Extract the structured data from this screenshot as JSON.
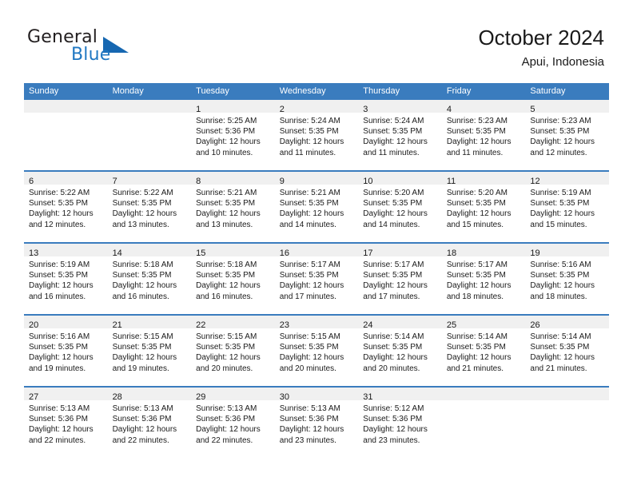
{
  "brand": {
    "name_part1": "General",
    "name_part2": "Blue",
    "logo_icon": "triangle-logo"
  },
  "header": {
    "title": "October 2024",
    "subtitle": "Apui, Indonesia"
  },
  "colors": {
    "header_blue": "#3a7cbe",
    "brand_blue": "#1f77c2",
    "day_band_gray": "#f0f0f0",
    "text": "#1a1a1a"
  },
  "weekdays": [
    "Sunday",
    "Monday",
    "Tuesday",
    "Wednesday",
    "Thursday",
    "Friday",
    "Saturday"
  ],
  "weeks": [
    [
      {
        "day": "",
        "sunrise": "",
        "sunset": "",
        "daylight_line1": "",
        "daylight_line2": ""
      },
      {
        "day": "",
        "sunrise": "",
        "sunset": "",
        "daylight_line1": "",
        "daylight_line2": ""
      },
      {
        "day": "1",
        "sunrise": "Sunrise: 5:25 AM",
        "sunset": "Sunset: 5:36 PM",
        "daylight_line1": "Daylight: 12 hours",
        "daylight_line2": "and 10 minutes."
      },
      {
        "day": "2",
        "sunrise": "Sunrise: 5:24 AM",
        "sunset": "Sunset: 5:35 PM",
        "daylight_line1": "Daylight: 12 hours",
        "daylight_line2": "and 11 minutes."
      },
      {
        "day": "3",
        "sunrise": "Sunrise: 5:24 AM",
        "sunset": "Sunset: 5:35 PM",
        "daylight_line1": "Daylight: 12 hours",
        "daylight_line2": "and 11 minutes."
      },
      {
        "day": "4",
        "sunrise": "Sunrise: 5:23 AM",
        "sunset": "Sunset: 5:35 PM",
        "daylight_line1": "Daylight: 12 hours",
        "daylight_line2": "and 11 minutes."
      },
      {
        "day": "5",
        "sunrise": "Sunrise: 5:23 AM",
        "sunset": "Sunset: 5:35 PM",
        "daylight_line1": "Daylight: 12 hours",
        "daylight_line2": "and 12 minutes."
      }
    ],
    [
      {
        "day": "6",
        "sunrise": "Sunrise: 5:22 AM",
        "sunset": "Sunset: 5:35 PM",
        "daylight_line1": "Daylight: 12 hours",
        "daylight_line2": "and 12 minutes."
      },
      {
        "day": "7",
        "sunrise": "Sunrise: 5:22 AM",
        "sunset": "Sunset: 5:35 PM",
        "daylight_line1": "Daylight: 12 hours",
        "daylight_line2": "and 13 minutes."
      },
      {
        "day": "8",
        "sunrise": "Sunrise: 5:21 AM",
        "sunset": "Sunset: 5:35 PM",
        "daylight_line1": "Daylight: 12 hours",
        "daylight_line2": "and 13 minutes."
      },
      {
        "day": "9",
        "sunrise": "Sunrise: 5:21 AM",
        "sunset": "Sunset: 5:35 PM",
        "daylight_line1": "Daylight: 12 hours",
        "daylight_line2": "and 14 minutes."
      },
      {
        "day": "10",
        "sunrise": "Sunrise: 5:20 AM",
        "sunset": "Sunset: 5:35 PM",
        "daylight_line1": "Daylight: 12 hours",
        "daylight_line2": "and 14 minutes."
      },
      {
        "day": "11",
        "sunrise": "Sunrise: 5:20 AM",
        "sunset": "Sunset: 5:35 PM",
        "daylight_line1": "Daylight: 12 hours",
        "daylight_line2": "and 15 minutes."
      },
      {
        "day": "12",
        "sunrise": "Sunrise: 5:19 AM",
        "sunset": "Sunset: 5:35 PM",
        "daylight_line1": "Daylight: 12 hours",
        "daylight_line2": "and 15 minutes."
      }
    ],
    [
      {
        "day": "13",
        "sunrise": "Sunrise: 5:19 AM",
        "sunset": "Sunset: 5:35 PM",
        "daylight_line1": "Daylight: 12 hours",
        "daylight_line2": "and 16 minutes."
      },
      {
        "day": "14",
        "sunrise": "Sunrise: 5:18 AM",
        "sunset": "Sunset: 5:35 PM",
        "daylight_line1": "Daylight: 12 hours",
        "daylight_line2": "and 16 minutes."
      },
      {
        "day": "15",
        "sunrise": "Sunrise: 5:18 AM",
        "sunset": "Sunset: 5:35 PM",
        "daylight_line1": "Daylight: 12 hours",
        "daylight_line2": "and 16 minutes."
      },
      {
        "day": "16",
        "sunrise": "Sunrise: 5:17 AM",
        "sunset": "Sunset: 5:35 PM",
        "daylight_line1": "Daylight: 12 hours",
        "daylight_line2": "and 17 minutes."
      },
      {
        "day": "17",
        "sunrise": "Sunrise: 5:17 AM",
        "sunset": "Sunset: 5:35 PM",
        "daylight_line1": "Daylight: 12 hours",
        "daylight_line2": "and 17 minutes."
      },
      {
        "day": "18",
        "sunrise": "Sunrise: 5:17 AM",
        "sunset": "Sunset: 5:35 PM",
        "daylight_line1": "Daylight: 12 hours",
        "daylight_line2": "and 18 minutes."
      },
      {
        "day": "19",
        "sunrise": "Sunrise: 5:16 AM",
        "sunset": "Sunset: 5:35 PM",
        "daylight_line1": "Daylight: 12 hours",
        "daylight_line2": "and 18 minutes."
      }
    ],
    [
      {
        "day": "20",
        "sunrise": "Sunrise: 5:16 AM",
        "sunset": "Sunset: 5:35 PM",
        "daylight_line1": "Daylight: 12 hours",
        "daylight_line2": "and 19 minutes."
      },
      {
        "day": "21",
        "sunrise": "Sunrise: 5:15 AM",
        "sunset": "Sunset: 5:35 PM",
        "daylight_line1": "Daylight: 12 hours",
        "daylight_line2": "and 19 minutes."
      },
      {
        "day": "22",
        "sunrise": "Sunrise: 5:15 AM",
        "sunset": "Sunset: 5:35 PM",
        "daylight_line1": "Daylight: 12 hours",
        "daylight_line2": "and 20 minutes."
      },
      {
        "day": "23",
        "sunrise": "Sunrise: 5:15 AM",
        "sunset": "Sunset: 5:35 PM",
        "daylight_line1": "Daylight: 12 hours",
        "daylight_line2": "and 20 minutes."
      },
      {
        "day": "24",
        "sunrise": "Sunrise: 5:14 AM",
        "sunset": "Sunset: 5:35 PM",
        "daylight_line1": "Daylight: 12 hours",
        "daylight_line2": "and 20 minutes."
      },
      {
        "day": "25",
        "sunrise": "Sunrise: 5:14 AM",
        "sunset": "Sunset: 5:35 PM",
        "daylight_line1": "Daylight: 12 hours",
        "daylight_line2": "and 21 minutes."
      },
      {
        "day": "26",
        "sunrise": "Sunrise: 5:14 AM",
        "sunset": "Sunset: 5:35 PM",
        "daylight_line1": "Daylight: 12 hours",
        "daylight_line2": "and 21 minutes."
      }
    ],
    [
      {
        "day": "27",
        "sunrise": "Sunrise: 5:13 AM",
        "sunset": "Sunset: 5:36 PM",
        "daylight_line1": "Daylight: 12 hours",
        "daylight_line2": "and 22 minutes."
      },
      {
        "day": "28",
        "sunrise": "Sunrise: 5:13 AM",
        "sunset": "Sunset: 5:36 PM",
        "daylight_line1": "Daylight: 12 hours",
        "daylight_line2": "and 22 minutes."
      },
      {
        "day": "29",
        "sunrise": "Sunrise: 5:13 AM",
        "sunset": "Sunset: 5:36 PM",
        "daylight_line1": "Daylight: 12 hours",
        "daylight_line2": "and 22 minutes."
      },
      {
        "day": "30",
        "sunrise": "Sunrise: 5:13 AM",
        "sunset": "Sunset: 5:36 PM",
        "daylight_line1": "Daylight: 12 hours",
        "daylight_line2": "and 23 minutes."
      },
      {
        "day": "31",
        "sunrise": "Sunrise: 5:12 AM",
        "sunset": "Sunset: 5:36 PM",
        "daylight_line1": "Daylight: 12 hours",
        "daylight_line2": "and 23 minutes."
      },
      {
        "day": "",
        "sunrise": "",
        "sunset": "",
        "daylight_line1": "",
        "daylight_line2": ""
      },
      {
        "day": "",
        "sunrise": "",
        "sunset": "",
        "daylight_line1": "",
        "daylight_line2": ""
      }
    ]
  ]
}
